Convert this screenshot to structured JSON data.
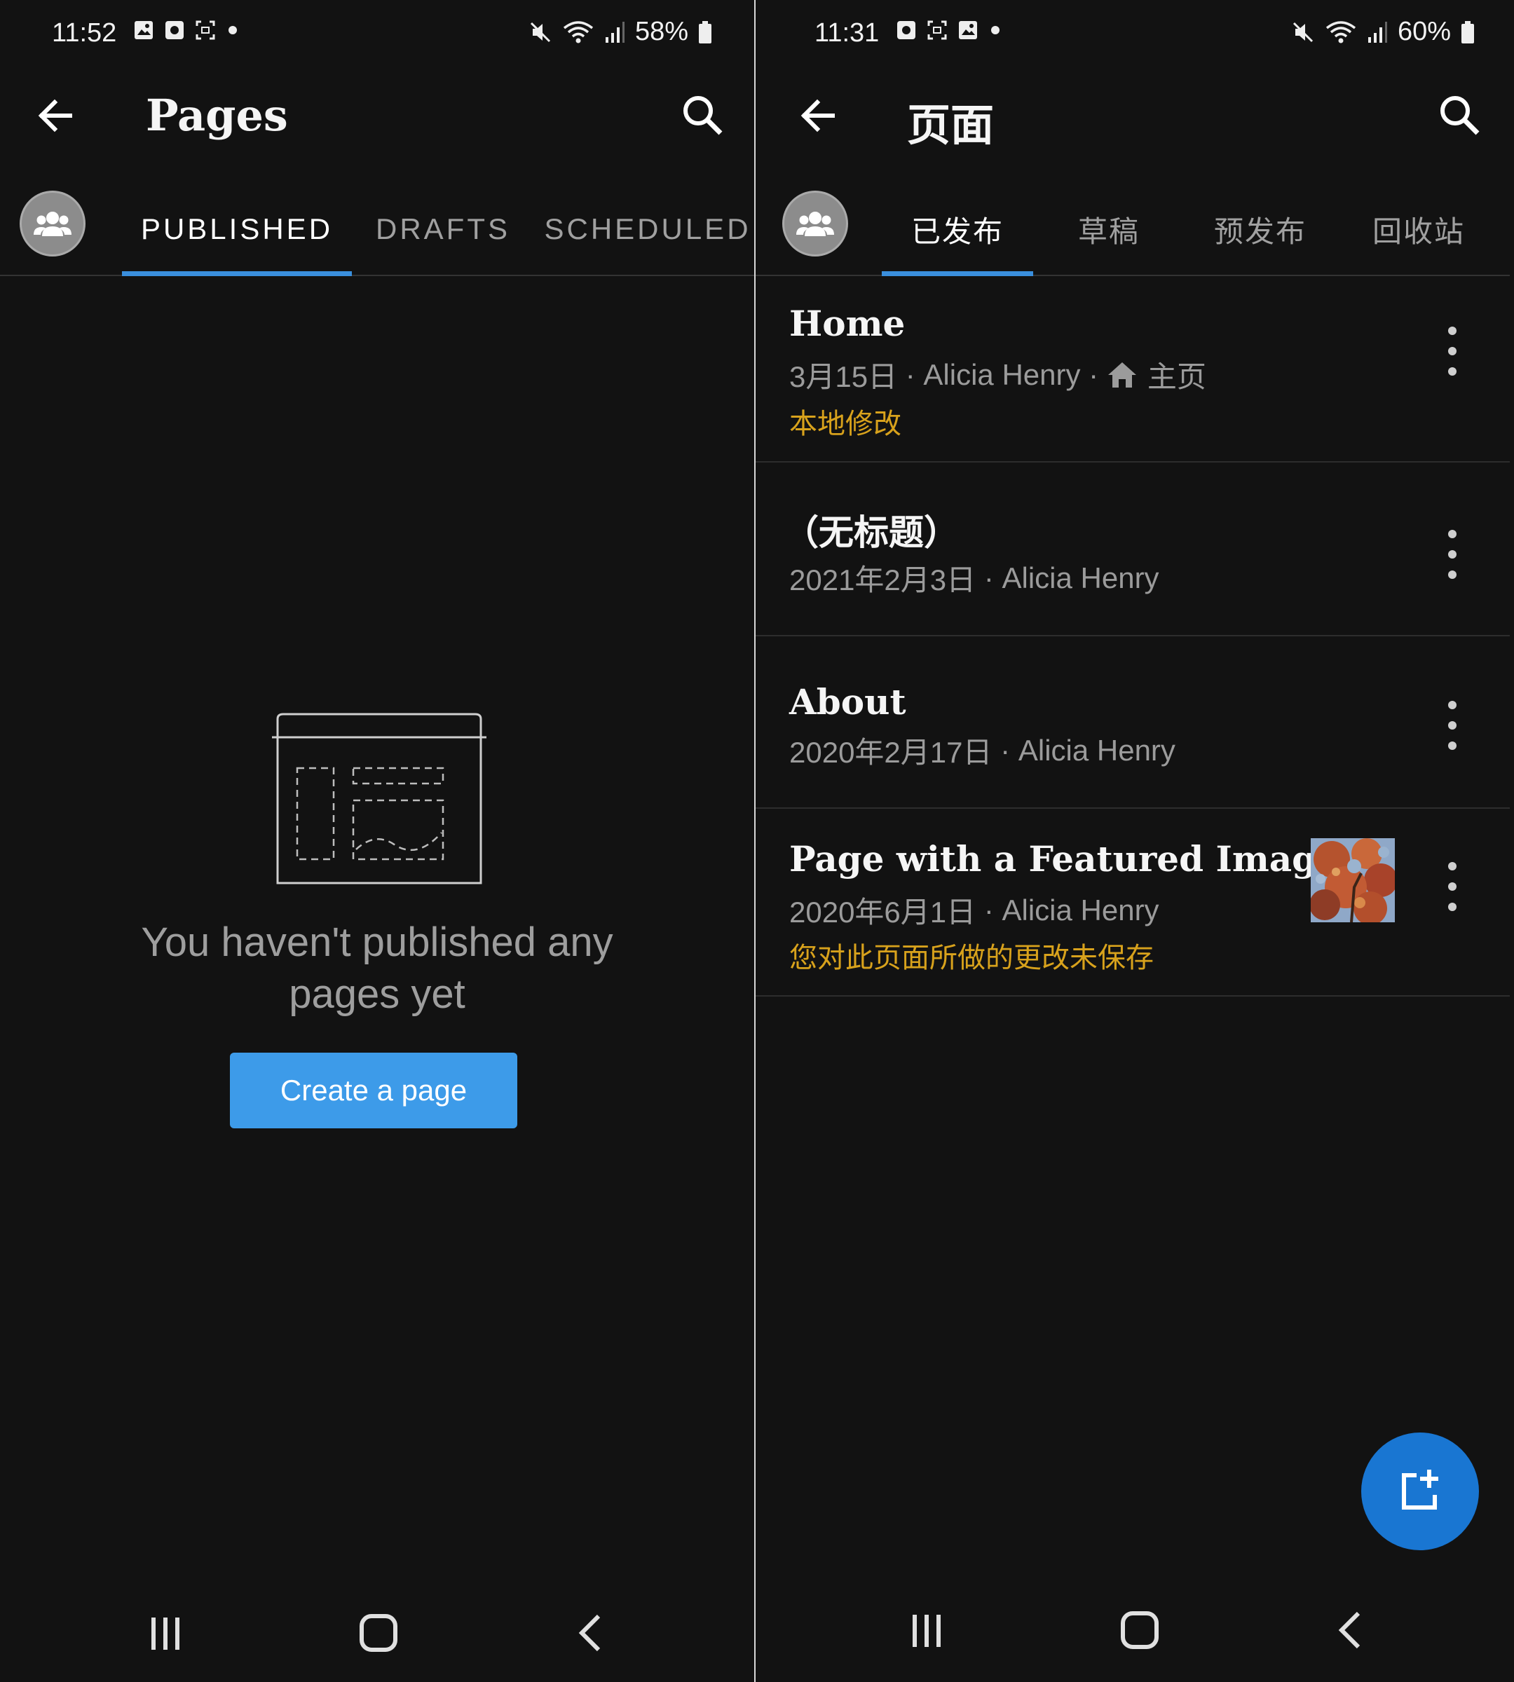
{
  "left": {
    "status": {
      "time": "11:52",
      "battery": "58%"
    },
    "header": {
      "title": "Pages"
    },
    "tabs": [
      {
        "label": "PUBLISHED",
        "active": true
      },
      {
        "label": "DRAFTS",
        "active": false
      },
      {
        "label": "SCHEDULED",
        "active": false
      }
    ],
    "empty": {
      "message": "You haven't published any pages yet",
      "button": "Create a page"
    }
  },
  "right": {
    "status": {
      "time": "11:31",
      "battery": "60%"
    },
    "header": {
      "title": "页面"
    },
    "tabs": [
      {
        "label": "已发布",
        "active": true
      },
      {
        "label": "草稿",
        "active": false
      },
      {
        "label": "预发布",
        "active": false
      },
      {
        "label": "回收站",
        "active": false
      }
    ],
    "pages": [
      {
        "title": "Home",
        "date": "3月15日",
        "author": "Alicia Henry",
        "badge": "主页",
        "note": "本地修改"
      },
      {
        "title": "（无标题）",
        "date": "2021年2月3日",
        "author": "Alicia Henry"
      },
      {
        "title": "About",
        "date": "2020年2月17日",
        "author": "Alicia Henry"
      },
      {
        "title": "Page with a Featured Image",
        "date": "2020年6月1日",
        "author": "Alicia Henry",
        "note": "您对此页面所做的更改未保存"
      }
    ]
  },
  "colors": {
    "background": "#121212",
    "accent": "#3a8fdd",
    "button": "#3d9be9",
    "fab": "#1976d2",
    "warning": "#d8a21c"
  },
  "icons": [
    "back-arrow-icon",
    "search-icon",
    "people-icon",
    "page-add-icon",
    "recent-apps-icon",
    "home-icon",
    "nav-back-icon",
    "house-icon"
  ]
}
